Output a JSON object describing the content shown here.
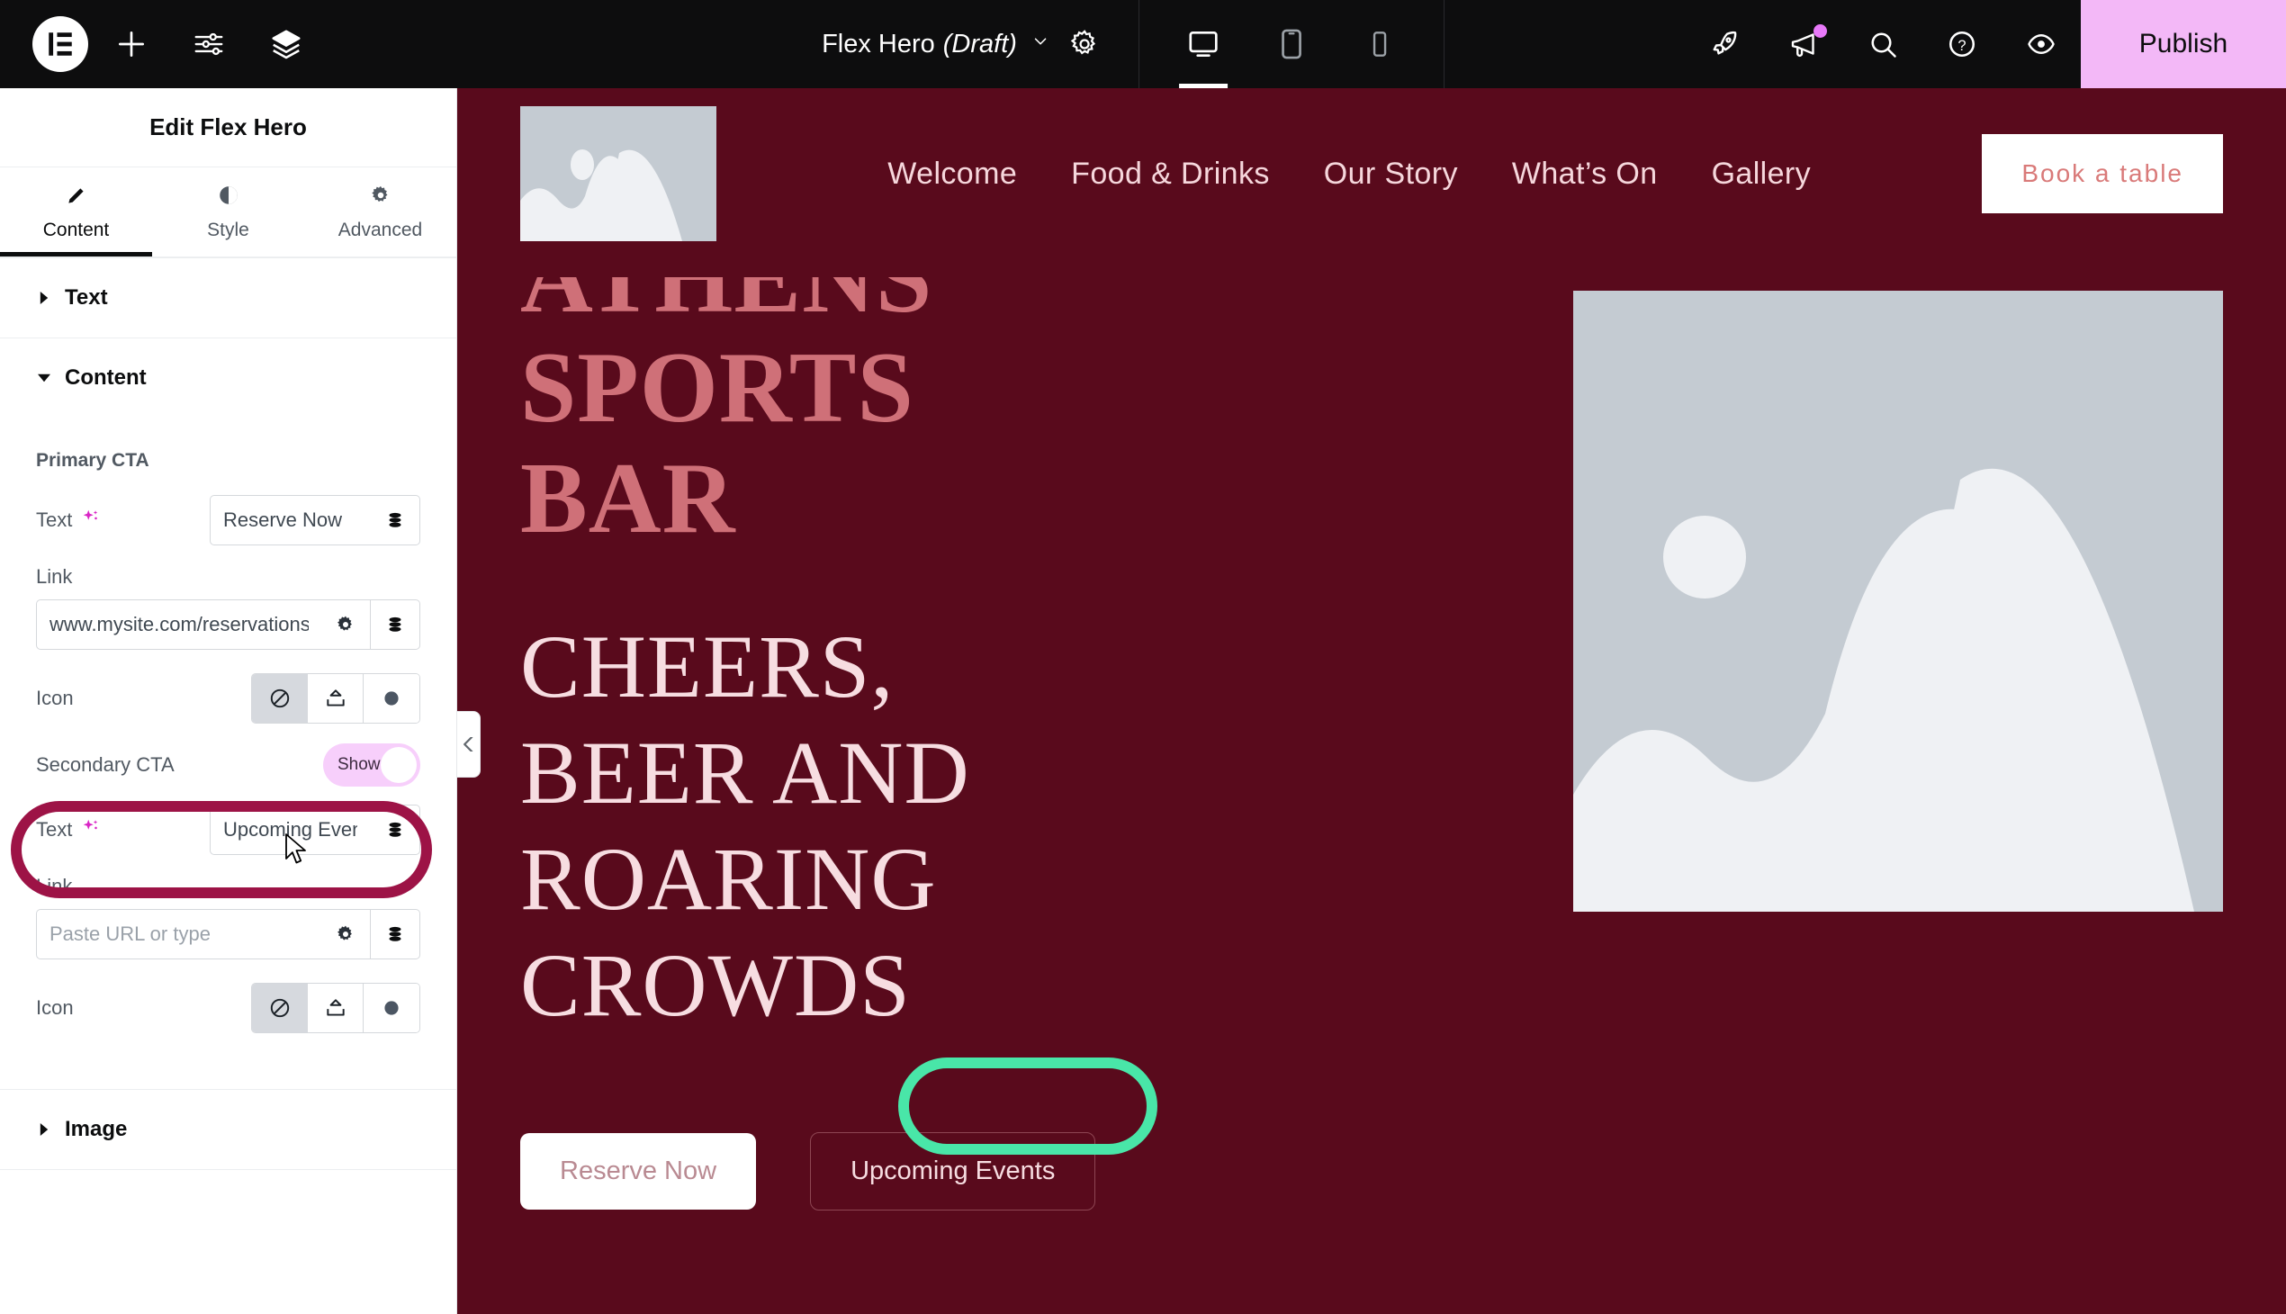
{
  "topbar": {
    "logo_icon": "elementor-logo-icon",
    "add_icon": "plus-icon",
    "settings_sliders_icon": "sliders-icon",
    "layers_icon": "layers-icon",
    "document_title": "Flex Hero",
    "document_status": "(Draft)",
    "chevron": "∨",
    "gear_icon": "gear-icon",
    "devices": [
      {
        "name": "desktop",
        "icon": "desktop-icon",
        "active": true
      },
      {
        "name": "tablet",
        "icon": "tablet-icon",
        "active": false
      },
      {
        "name": "mobile",
        "icon": "mobile-icon",
        "active": false
      }
    ],
    "right_icons": [
      {
        "name": "rocket-icon"
      },
      {
        "name": "megaphone-icon",
        "badge": true
      },
      {
        "name": "search-icon"
      },
      {
        "name": "help-icon"
      },
      {
        "name": "preview-eye-icon"
      }
    ],
    "publish_label": "Publish",
    "publish_color": "#f3b8f7"
  },
  "panel": {
    "title": "Edit Flex Hero",
    "tabs": [
      {
        "label": "Content",
        "icon": "pencil-icon",
        "active": true
      },
      {
        "label": "Style",
        "icon": "contrast-icon",
        "active": false
      },
      {
        "label": "Advanced",
        "icon": "gear-icon",
        "active": false
      }
    ],
    "sections": [
      {
        "label": "Text",
        "expanded": false
      },
      {
        "label": "Content",
        "expanded": true
      },
      {
        "label": "Image",
        "expanded": false
      }
    ],
    "primary_cta": {
      "group_label": "Primary CTA",
      "text_label": "Text",
      "ai_icon": "ai-sparkle-icon",
      "text_value": "Reserve Now",
      "text_dynamic_icon": "dynamic-tags-icon",
      "link_label": "Link",
      "link_value": "www.mysite.com/reservations",
      "link_placeholder": "Paste URL or type",
      "link_options_icon": "gear-icon",
      "link_dynamic_icon": "dynamic-tags-icon",
      "icon_label": "Icon",
      "icon_options": [
        {
          "name": "none-icon",
          "active": true
        },
        {
          "name": "upload-icon",
          "active": false
        },
        {
          "name": "circle-icon",
          "active": false
        }
      ]
    },
    "secondary_cta": {
      "group_label": "Secondary CTA",
      "toggle_label": "Show",
      "toggle_on": true,
      "text_label": "Text",
      "ai_icon": "ai-sparkle-icon",
      "text_value": "Upcoming Events",
      "text_dynamic_icon": "dynamic-tags-icon",
      "link_label": "Link",
      "link_value": "",
      "link_placeholder": "Paste URL or type",
      "link_options_icon": "gear-icon",
      "link_dynamic_icon": "dynamic-tags-icon",
      "icon_label": "Icon",
      "icon_options": [
        {
          "name": "none-icon",
          "active": true
        },
        {
          "name": "upload-icon",
          "active": false
        },
        {
          "name": "circle-icon",
          "active": false
        }
      ]
    },
    "collapse_handle_icon": "chevron-left-icon"
  },
  "canvas": {
    "background_color": "#590a1c",
    "logo_icon": "image-placeholder-icon",
    "nav_links": [
      "Welcome",
      "Food & Drinks",
      "Our Story",
      "What’s On",
      "Gallery"
    ],
    "book_button_label": "Book a table",
    "hero": {
      "kicker": "ATHENS",
      "title_line1": "SPORTS",
      "title_line2": "BAR",
      "subtitle_line1": "CHEERS,",
      "subtitle_line2": "BEER AND",
      "subtitle_line3": "ROARING",
      "subtitle_line4": "CROWDS",
      "cta_primary_label": "Reserve Now",
      "cta_secondary_label": "Upcoming Events",
      "image_icon": "image-placeholder-icon"
    }
  },
  "annotations": {
    "maroon_highlight_color": "#9d1346",
    "teal_highlight_color": "#49e6a8",
    "cursor_icon": "mouse-cursor-icon"
  }
}
